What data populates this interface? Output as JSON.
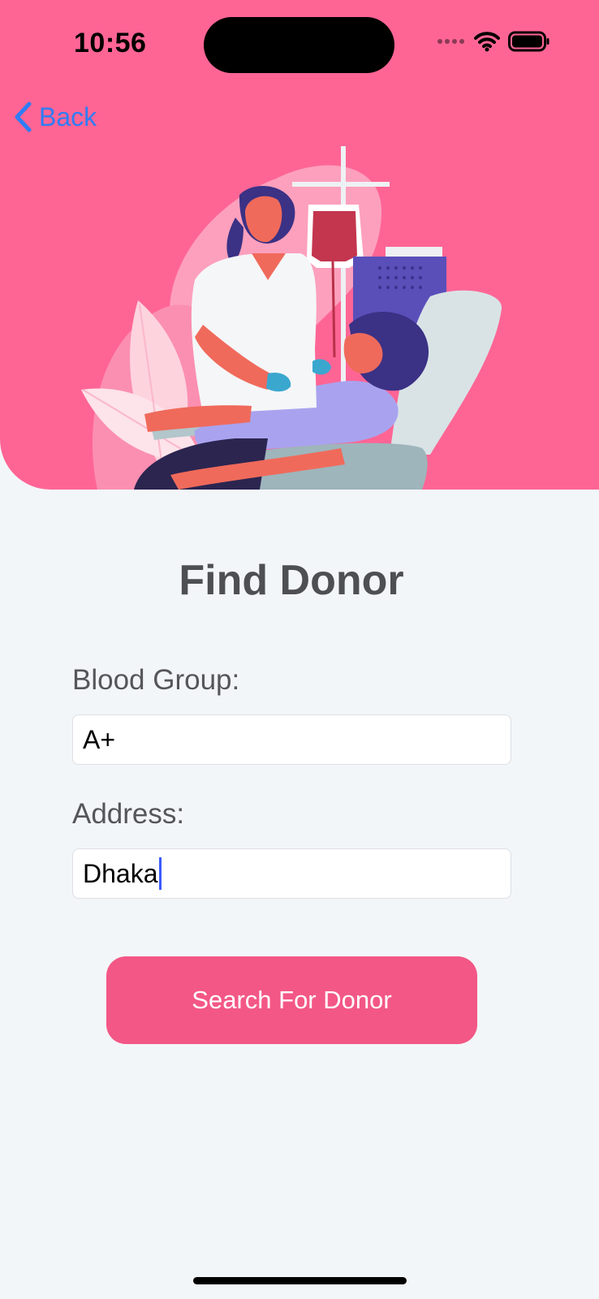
{
  "status_bar": {
    "time": "10:56"
  },
  "nav": {
    "back_label": "Back",
    "back_icon": "chevron-left-icon"
  },
  "illustration": {
    "name": "blood-donation-illustration"
  },
  "form": {
    "title": "Find Donor",
    "blood_group_label": "Blood Group:",
    "blood_group_value": "A+",
    "address_label": "Address:",
    "address_value": "Dhaka",
    "submit_label": "Search For Donor"
  },
  "colors": {
    "header_bg": "#fe6595",
    "button_bg": "#f35786",
    "link": "#2f7cf6",
    "page_bg": "#f3f6f9"
  }
}
